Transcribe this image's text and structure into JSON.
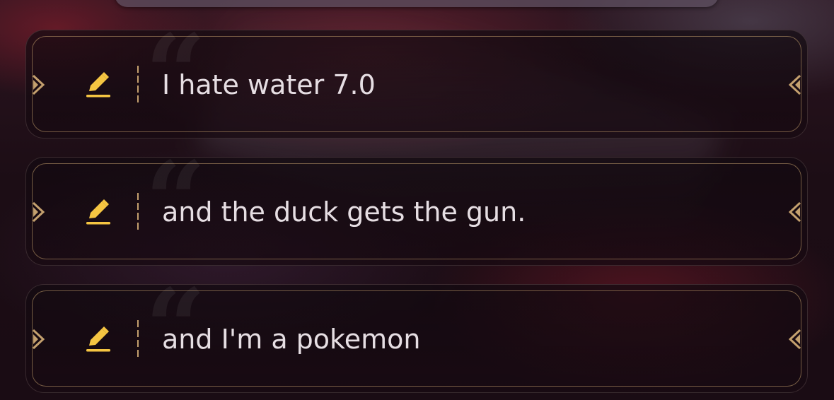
{
  "entries": [
    {
      "text": "I hate water 7.0"
    },
    {
      "text": "and the duck gets the gun."
    },
    {
      "text": "and I'm a pokemon"
    }
  ],
  "icons": {
    "edit": "pencil-icon",
    "left_ornament": "chevron-right-ornament-icon",
    "right_ornament": "chevron-left-ornament-icon",
    "quote": "quote-mark-icon"
  },
  "colors": {
    "accent_gold": "#f5c542",
    "frame_gold": "#c4a06e",
    "text": "#e6dee3"
  }
}
